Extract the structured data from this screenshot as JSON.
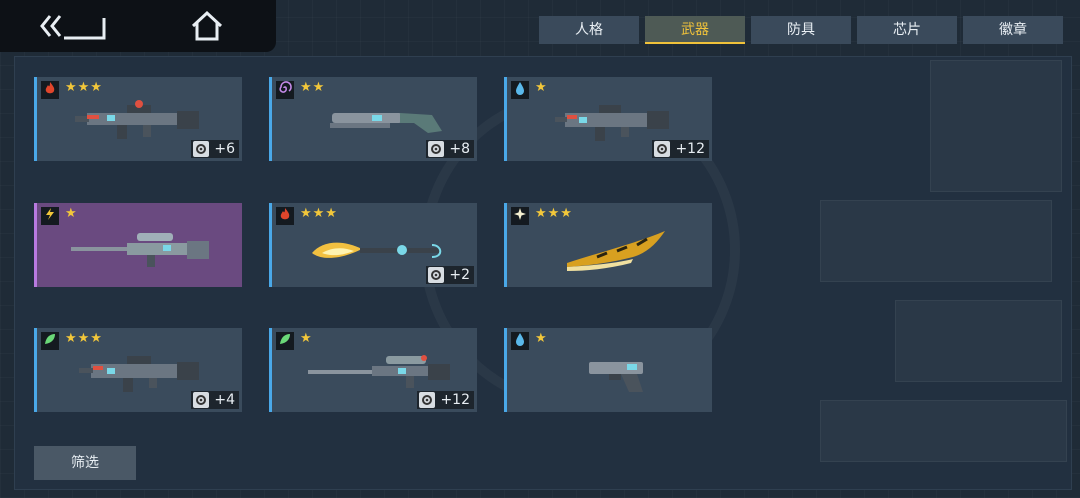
{
  "tabs": [
    {
      "label": "人格"
    },
    {
      "label": "武器"
    },
    {
      "label": "防具"
    },
    {
      "label": "芯片"
    },
    {
      "label": "徽章"
    }
  ],
  "active_tab": "武器",
  "colors": {
    "accent": "#f0c23a",
    "card": "#3a4b5c",
    "card_rare": "#6a4a80",
    "border_blue": "#4aa8e8"
  },
  "weapons": [
    {
      "element": "fire-icon",
      "stars": "★★★",
      "bonus": "+6",
      "weapon": "assault-rifle"
    },
    {
      "element": "vortex-icon",
      "stars": "★★",
      "bonus": "+8",
      "weapon": "shotgun"
    },
    {
      "element": "water-drop-icon",
      "stars": "★",
      "bonus": "+12",
      "weapon": "smg"
    },
    {
      "element": "lightning-icon",
      "stars": "★",
      "bonus": "",
      "weapon": "sniper-rifle"
    },
    {
      "element": "fire-icon",
      "stars": "★★★",
      "bonus": "+2",
      "weapon": "flame-staff"
    },
    {
      "element": "sparkle-icon",
      "stars": "★★★",
      "bonus": "",
      "weapon": "golden-blade"
    },
    {
      "element": "leaf-icon",
      "stars": "★★★",
      "bonus": "+4",
      "weapon": "assault-rifle"
    },
    {
      "element": "leaf-icon",
      "stars": "★",
      "bonus": "+12",
      "weapon": "long-rifle"
    },
    {
      "element": "water-drop-icon",
      "stars": "★",
      "bonus": "",
      "weapon": "pistol"
    }
  ],
  "filter_label": "筛选"
}
